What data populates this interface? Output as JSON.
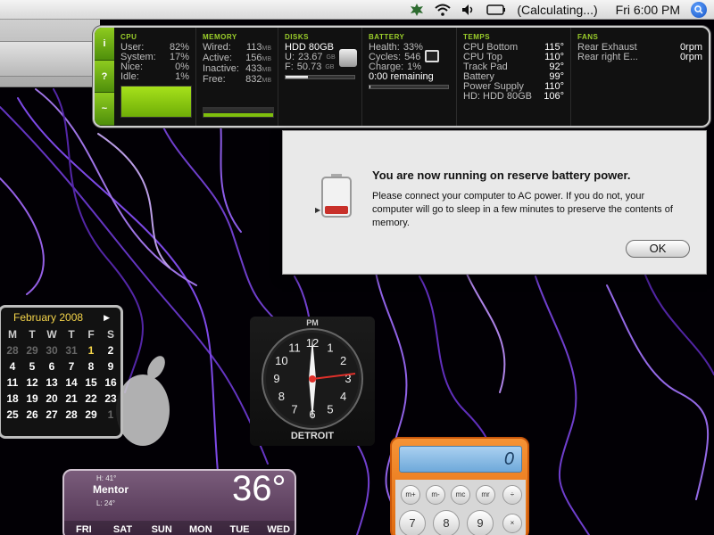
{
  "menubar": {
    "status": "(Calculating...)",
    "clock": "Fri 6:00 PM",
    "icons": [
      "leaf-menu-icon",
      "wifi-icon",
      "volume-icon",
      "battery-icon",
      "spotlight-icon"
    ]
  },
  "istat": {
    "side_buttons": [
      "i",
      "?",
      "~"
    ],
    "cpu": {
      "title": "CPU",
      "rows": [
        {
          "label": "User:",
          "value": "82%"
        },
        {
          "label": "System:",
          "value": "17%"
        },
        {
          "label": "Nice:",
          "value": "0%"
        },
        {
          "label": "Idle:",
          "value": "1%"
        }
      ]
    },
    "memory": {
      "title": "MEMORY",
      "rows": [
        {
          "label": "Wired:",
          "value": "113",
          "unit": "MB"
        },
        {
          "label": "Active:",
          "value": "156",
          "unit": "MB"
        },
        {
          "label": "Inactive:",
          "value": "433",
          "unit": "MB"
        },
        {
          "label": "Free:",
          "value": "832",
          "unit": "MB"
        }
      ]
    },
    "disks": {
      "title": "DISKS",
      "name": "HDD 80GB",
      "used_label": "U:",
      "used": "23.67",
      "free_label": "F:",
      "free": "50.73",
      "unit": "GB",
      "used_fraction": 0.32
    },
    "battery": {
      "title": "BATTERY",
      "rows": [
        {
          "label": "Health:",
          "value": "33%"
        },
        {
          "label": "Cycles:",
          "value": "546"
        },
        {
          "label": "Charge:",
          "value": "1%"
        }
      ],
      "remaining": "0:00 remaining"
    },
    "temps": {
      "title": "TEMPS",
      "rows": [
        {
          "label": "CPU Bottom",
          "value": "115°"
        },
        {
          "label": "CPU Top",
          "value": "110°"
        },
        {
          "label": "Track Pad",
          "value": "92°"
        },
        {
          "label": "Battery",
          "value": "99°"
        },
        {
          "label": "Power Supply",
          "value": "110°"
        },
        {
          "label": "HD: HDD 80GB",
          "value": "106°"
        }
      ]
    },
    "fans": {
      "title": "FANS",
      "rows": [
        {
          "label": "Rear Exhaust",
          "value": "0rpm"
        },
        {
          "label": "Rear right E...",
          "value": "0rpm"
        }
      ]
    }
  },
  "alert": {
    "title": "You are now running on reserve battery power.",
    "message": "Please connect your computer to AC power. If you do not, your computer will go to sleep in a few minutes to preserve the contents of memory.",
    "ok_label": "OK"
  },
  "calendar": {
    "month": "February 2008",
    "weekday_headers": [
      "M",
      "T",
      "W",
      "T",
      "F",
      "S"
    ],
    "weeks": [
      [
        "28",
        "29",
        "30",
        "31",
        "1",
        "2"
      ],
      [
        "4",
        "5",
        "6",
        "7",
        "8",
        "9"
      ],
      [
        "11",
        "12",
        "13",
        "14",
        "15",
        "16"
      ],
      [
        "18",
        "19",
        "20",
        "21",
        "22",
        "23"
      ],
      [
        "25",
        "26",
        "27",
        "28",
        "29",
        "1"
      ]
    ]
  },
  "clock": {
    "ampm": "PM",
    "city": "DETROIT",
    "numerals": [
      "12",
      "1",
      "2",
      "3",
      "4",
      "5",
      "6",
      "7",
      "8",
      "9",
      "10",
      "11"
    ]
  },
  "weather": {
    "city": "Mentor",
    "high": "H: 41°",
    "low": "L: 24°",
    "temp": "36°",
    "days": [
      "FRI",
      "SAT",
      "SUN",
      "MON",
      "TUE",
      "WED"
    ]
  },
  "calculator": {
    "display": "0",
    "keys_top": [
      "m+",
      "m-",
      "mc",
      "mr",
      "÷"
    ],
    "keys_bottom": [
      "7",
      "8",
      "9",
      "×"
    ]
  },
  "colors": {
    "istat_green": "#9ccf2b",
    "calendar_yellow": "#f4d44a",
    "calculator_orange": "#f08021"
  }
}
